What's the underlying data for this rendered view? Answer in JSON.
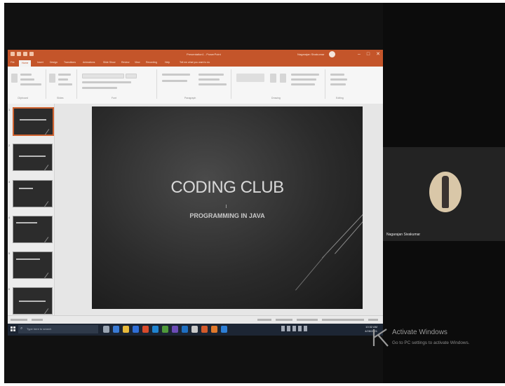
{
  "meeting": {
    "participant_name": "Nagarajan Sivakumar"
  },
  "powerpoint": {
    "doc_title": "Presentation1 - PowerPoint",
    "signin_name": "Nagarajan Sivakumar",
    "window_controls": [
      "–",
      "□",
      "✕"
    ],
    "tabs": [
      "File",
      "Home",
      "Insert",
      "Design",
      "Transitions",
      "Animations",
      "Slide Show",
      "Review",
      "View",
      "Recording",
      "Help",
      "Tell me what you want to do"
    ],
    "active_tab": "Home",
    "ribbon_groups": [
      "Clipboard",
      "Slides",
      "Font",
      "Paragraph",
      "Drawing",
      "Editing"
    ],
    "slide_count": 6,
    "selected_slide": 1,
    "slide": {
      "title": "CODING CLUB",
      "subtitle": "PROGRAMMING IN JAVA"
    }
  },
  "taskbar": {
    "search_placeholder": "Type here to search",
    "time": "10:32 AM",
    "date": "4/28/2021"
  },
  "activation": {
    "title": "Activate Windows",
    "subtitle": "Go to PC settings to activate Windows."
  },
  "colors": {
    "ppt_accent": "#c4552a",
    "meeting_background": "#111111",
    "taskbar": "#1d2634"
  }
}
